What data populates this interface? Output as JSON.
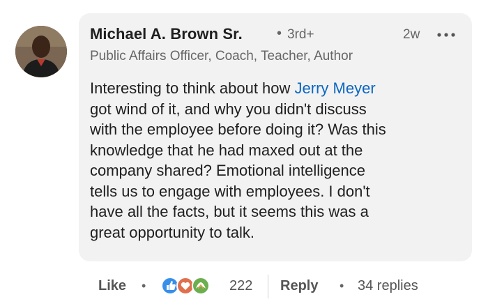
{
  "author": {
    "name": "Michael A. Brown Sr.",
    "bullet": "•",
    "degree": "3rd+",
    "headline": "Public Affairs Officer, Coach, Teacher, Author",
    "time": "2w",
    "avatar_icon": "profile-photo"
  },
  "comment": {
    "prefix": "Interesting to think about how ",
    "mention": "Jerry Meyer",
    "line1_rest": "got wind of it, and why you didn't discuss",
    "line2": "with the employee before doing it? Was this",
    "line3": "knowledge that he had maxed out at the",
    "line4": "company shared? Emotional intelligence",
    "line5": "tells us to engage with employees. I don't",
    "line6": "have all the facts, but it seems this was a",
    "line7": "great opportunity to talk."
  },
  "actions": {
    "like_label": "Like",
    "separator": "•",
    "reactions_icons": [
      "like-reaction-icon",
      "love-reaction-icon",
      "support-reaction-icon"
    ],
    "reaction_count": "222",
    "reply_label": "Reply",
    "replies_label": "34 replies"
  },
  "colors": {
    "bubble": "#f2f2f2",
    "mention": "#0a66c2",
    "like_blue": "#378fe9",
    "love_red": "#df704d",
    "support_green": "#6dae4f"
  }
}
